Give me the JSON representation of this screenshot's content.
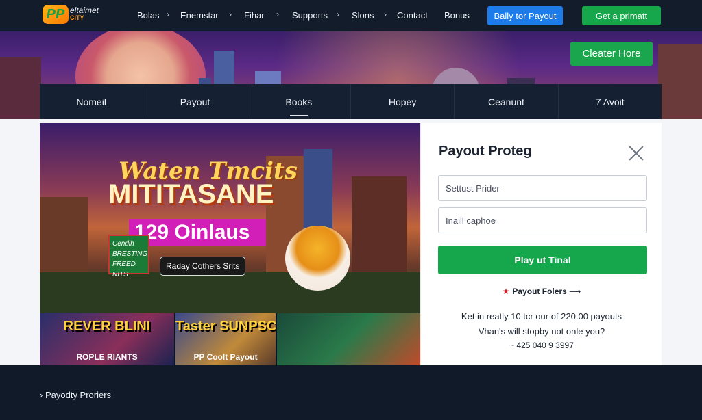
{
  "header": {
    "logo_line1": "eltaimet",
    "logo_line2": "CITY",
    "logo_badge": "PP",
    "nav": [
      "Bolas",
      "Enemstar",
      "Fihar",
      "Supports",
      "Slons",
      "Contact",
      "Bonus"
    ],
    "button_blue": "Bally tor Payout",
    "button_green": "Get a primatt"
  },
  "hero": {
    "cta_label": "Cleater Hore"
  },
  "tabs": [
    "Nomeil",
    "Payout",
    "Books",
    "Hopey",
    "Ceanunt",
    "7 Avoit"
  ],
  "active_tab": "Books",
  "promo": {
    "title_script": "Waten Tmcits",
    "title_main": "MITITASANE",
    "badge": "129 Oinlaus",
    "sign": "Cendih BRESTING FREED NITS",
    "chip": "Raday Cothers Srits",
    "tiles": [
      {
        "big": "REVER BLINI",
        "label": "ROPLE RIANTS"
      },
      {
        "big": "Taster SUNPSCAY",
        "label": "PP Coolt Payout"
      },
      {
        "big": "",
        "label": ""
      }
    ]
  },
  "panel": {
    "title": "Payout Proteg",
    "field1_placeholder": "Settust Prider",
    "field2_placeholder": "Inaill caphoe",
    "play_button": "Play ut Tinal",
    "link": "Payout Folers",
    "info_line1": "Ket in reatly 10 tcr our of 220.00 payouts",
    "info_line2": "Vhan's will stopby not onle you?",
    "info_line3": "~ 425 040 9 3997"
  },
  "footer": {
    "link": "Payodty Proriers"
  },
  "colors": {
    "primary_green": "#16a64b",
    "primary_blue": "#1e7bea",
    "nav_bg": "#121c2b"
  }
}
